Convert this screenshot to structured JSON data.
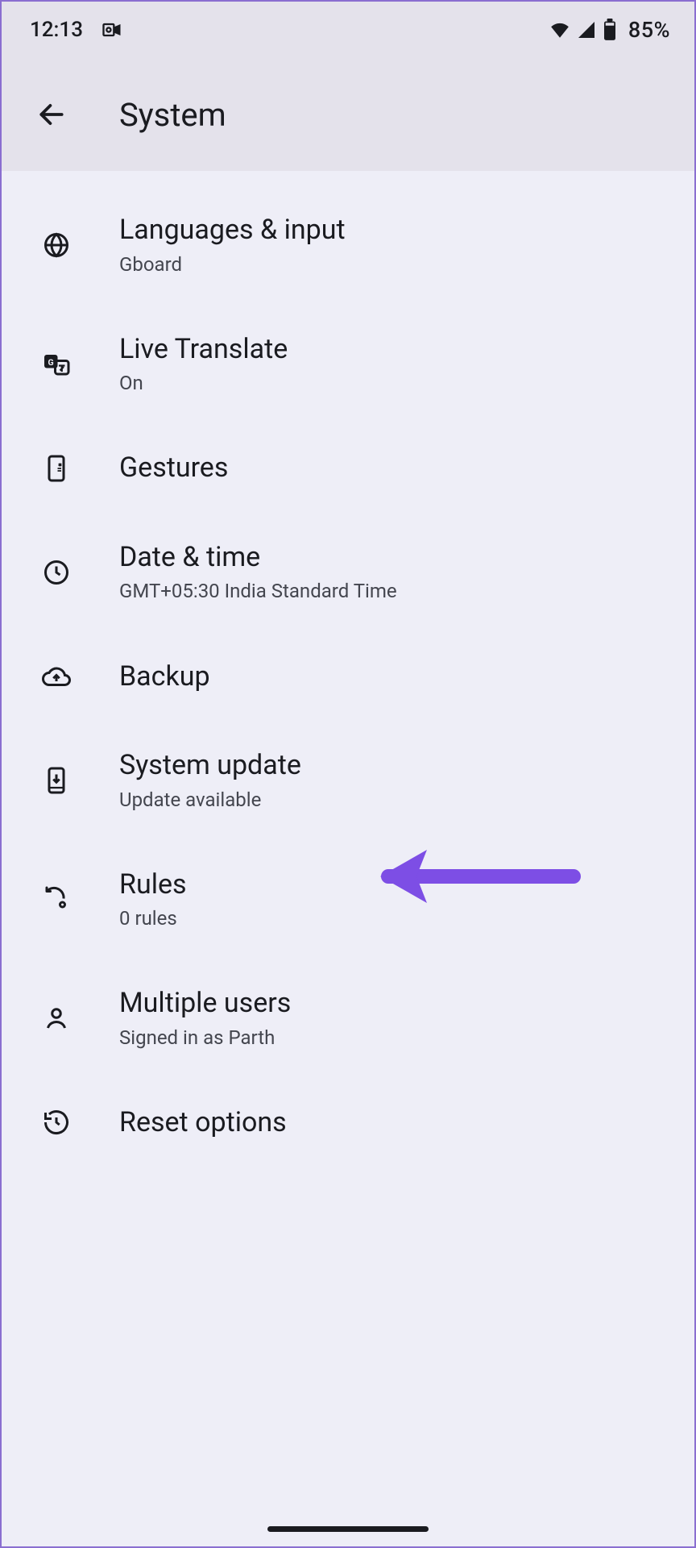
{
  "status": {
    "time": "12:13",
    "battery_pct": "85%"
  },
  "header": {
    "title": "System"
  },
  "items": [
    {
      "title": "Languages & input",
      "sub": "Gboard"
    },
    {
      "title": "Live Translate",
      "sub": "On"
    },
    {
      "title": "Gestures",
      "sub": ""
    },
    {
      "title": "Date & time",
      "sub": "GMT+05:30 India Standard Time"
    },
    {
      "title": "Backup",
      "sub": ""
    },
    {
      "title": "System update",
      "sub": "Update available"
    },
    {
      "title": "Rules",
      "sub": "0 rules"
    },
    {
      "title": "Multiple users",
      "sub": "Signed in as Parth"
    },
    {
      "title": "Reset options",
      "sub": ""
    }
  ],
  "annotation": {
    "arrow_color": "#7d4ee5"
  }
}
